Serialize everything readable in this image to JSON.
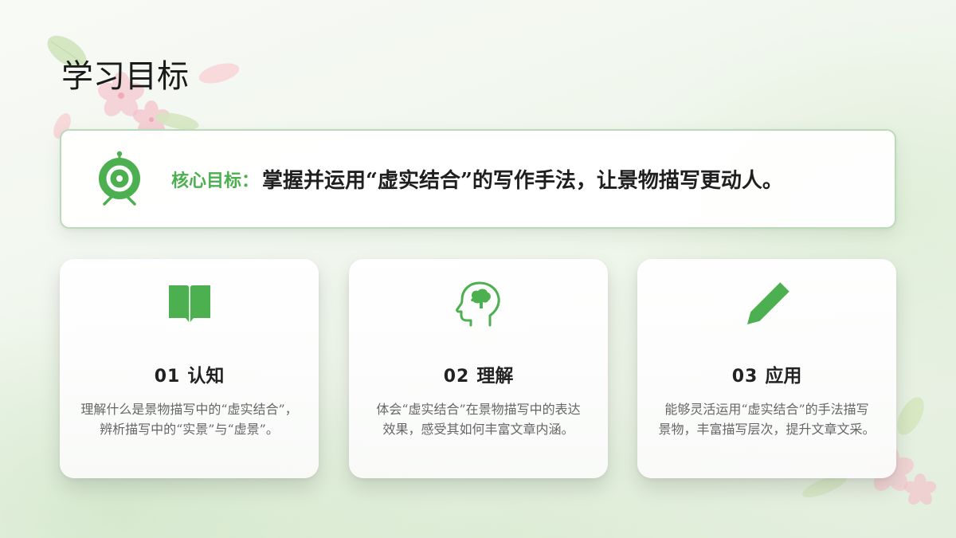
{
  "slide": {
    "title": "学习目标"
  },
  "core_goal": {
    "icon": "target-icon",
    "label": "核心目标：",
    "text": "掌握并运用“虚实结合”的写作手法，让景物描写更动人。"
  },
  "cards": [
    {
      "icon": "book-icon",
      "number": "01",
      "title": "认知",
      "desc_lines": [
        "理解什么是景物描写中的“虚实结合”，",
        "辨析描写中的“实景”与“虚景”。"
      ]
    },
    {
      "icon": "head-brain-icon",
      "number": "02",
      "title": "理解",
      "desc_lines": [
        "体会“虚实结合”在景物描写中的表达",
        "效果，感受其如何丰富文章内涵。"
      ]
    },
    {
      "icon": "pencil-icon",
      "number": "03",
      "title": "应用",
      "desc_lines": [
        "能够灵活运用“虚实结合”的手法描写",
        "景物，丰富描写层次，提升文章文采。"
      ]
    }
  ],
  "decorations": [
    "cherry-blossom-icon",
    "leaf-icon"
  ],
  "colors": {
    "accent": "#4caf50",
    "title_text": "#1a1a1a",
    "heading_text": "#222222",
    "body_text": "#666666",
    "core_border": "#b9dcb8"
  }
}
